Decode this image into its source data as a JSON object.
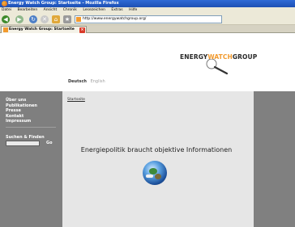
{
  "window": {
    "title": "Energy Watch Group: Startseite - Mozilla Firefox"
  },
  "menubar": {
    "items": [
      "Datei",
      "Bearbeiten",
      "Ansicht",
      "Chronik",
      "Lesezeichen",
      "Extras",
      "Hilfe"
    ]
  },
  "navbar": {
    "url": "http://www.energywatchgroup.org/"
  },
  "tab": {
    "label": "Energy Watch Group: Startseite"
  },
  "header": {
    "logo_prefix": "ENERGY",
    "logo_highlight": "WATCH",
    "logo_suffix": "GROUP",
    "language_active": "Deutsch",
    "language_inactive": "English"
  },
  "sidebar": {
    "items": [
      "Über uns",
      "Publikationen",
      "Presse",
      "Kontakt",
      "Impressum"
    ],
    "search_title": "Suchen & Finden",
    "search_button": "Go"
  },
  "main": {
    "breadcrumb": "Startseite",
    "headline": "Energiepolitik braucht objektive Informationen"
  },
  "colors": {
    "accent": "#f29a2e",
    "sidebar_bg": "#7f7f7f",
    "content_bg": "#e6e6e6"
  }
}
